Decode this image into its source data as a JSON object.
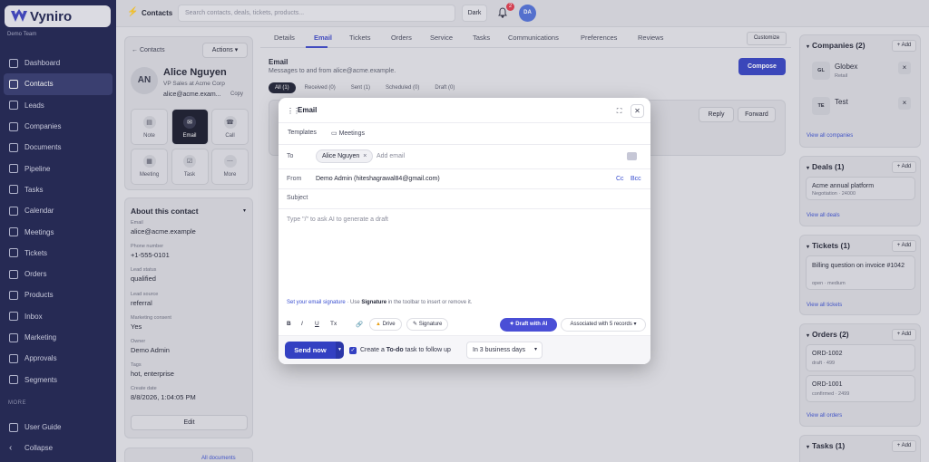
{
  "app": {
    "name": "Vyniro",
    "team": "Demo Team"
  },
  "sidebar": {
    "items": [
      {
        "label": "Dashboard",
        "icon": "home-icon"
      },
      {
        "label": "Contacts",
        "icon": "users-icon",
        "active": true
      },
      {
        "label": "Leads",
        "icon": "funnel-icon"
      },
      {
        "label": "Companies",
        "icon": "building-icon"
      },
      {
        "label": "Documents",
        "icon": "document-icon"
      },
      {
        "label": "Pipeline",
        "icon": "chart-icon"
      },
      {
        "label": "Tasks",
        "icon": "check-square-icon"
      },
      {
        "label": "Calendar",
        "icon": "calendar-icon"
      },
      {
        "label": "Meetings",
        "icon": "clock-icon"
      },
      {
        "label": "Tickets",
        "icon": "ticket-icon"
      },
      {
        "label": "Orders",
        "icon": "cart-icon"
      },
      {
        "label": "Products",
        "icon": "box-icon"
      },
      {
        "label": "Inbox",
        "icon": "inbox-icon"
      },
      {
        "label": "Marketing",
        "icon": "megaphone-icon"
      },
      {
        "label": "Approvals",
        "icon": "shield-check-icon"
      },
      {
        "label": "Segments",
        "icon": "segments-icon"
      }
    ],
    "more_label": "MORE",
    "bottom_items": [
      {
        "label": "User Guide",
        "icon": "book-icon"
      },
      {
        "label": "Collapse",
        "icon": "chevron-left-icon"
      }
    ]
  },
  "topbar": {
    "title": "Contacts",
    "search_placeholder": "Search contacts, deals, tickets, products...",
    "dark_label": "Dark",
    "notification_count": "2",
    "user_initials": "DA"
  },
  "contact": {
    "back_label": "Contacts",
    "actions_label": "Actions",
    "initials": "AN",
    "name": "Alice Nguyen",
    "role": "VP Sales at Acme Corp",
    "email_short": "alice@acme.exam...",
    "copy_label": "Copy",
    "quick_actions": [
      {
        "label": "Note",
        "icon": "note-icon"
      },
      {
        "label": "Email",
        "icon": "mail-icon",
        "active": true
      },
      {
        "label": "Call",
        "icon": "phone-icon"
      },
      {
        "label": "Meeting",
        "icon": "calendar-icon"
      },
      {
        "label": "Task",
        "icon": "check-square-icon"
      },
      {
        "label": "More",
        "icon": "more-icon"
      }
    ]
  },
  "about": {
    "title": "About this contact",
    "fields": [
      {
        "label": "Email",
        "value": "alice@acme.example"
      },
      {
        "label": "Phone number",
        "value": "+1-555-0101"
      },
      {
        "label": "Lead status",
        "value": "qualified"
      },
      {
        "label": "Lead source",
        "value": "referral"
      },
      {
        "label": "Marketing consent",
        "value": "Yes"
      },
      {
        "label": "Owner",
        "value": "Demo Admin"
      },
      {
        "label": "Tags",
        "value": "hot, enterprise"
      },
      {
        "label": "Create date",
        "value": "8/8/2026, 1:04:05 PM"
      }
    ],
    "edit_label": "Edit",
    "docs_link": "All documents"
  },
  "tabs": [
    "Details",
    "Email",
    "Tickets",
    "Orders",
    "Service",
    "Tasks",
    "Communications",
    "Preferences",
    "Reviews"
  ],
  "customize_label": "Customize",
  "email_panel": {
    "title": "Email",
    "subtitle": "Messages to and from alice@acme.example.",
    "compose_label": "Compose",
    "filters": [
      "All (1)",
      "Received (0)",
      "Sent (1)",
      "Scheduled (0)",
      "Draft (0)"
    ],
    "reply_label": "Reply",
    "forward_label": "Forward"
  },
  "right_panel": {
    "companies": {
      "title": "Companies (2)",
      "add_label": "+ Add",
      "items": [
        {
          "logo": "GL",
          "name": "Globex",
          "sub": "Retail"
        },
        {
          "logo": "TE",
          "name": "Test",
          "sub": ""
        }
      ],
      "link": "View all companies"
    },
    "deals": {
      "title": "Deals (1)",
      "add_label": "+ Add",
      "item": {
        "name": "Acme annual platform",
        "sub": "Negotiation · 24000"
      },
      "link": "View all deals"
    },
    "tickets": {
      "title": "Tickets (1)",
      "add_label": "+ Add",
      "item": {
        "name": "Billing question on invoice #1042",
        "sub": "open · medium"
      },
      "link": "View all tickets"
    },
    "orders": {
      "title": "Orders (2)",
      "add_label": "+ Add",
      "items": [
        {
          "name": "ORD-1002",
          "sub": "draft · 499"
        },
        {
          "name": "ORD-1001",
          "sub": "confirmed · 2499"
        }
      ],
      "link": "View all orders"
    },
    "tasks": {
      "title": "Tasks (1)",
      "add_label": "+ Add"
    }
  },
  "modal": {
    "title": "Email",
    "templates_label": "Templates",
    "meetings_label": "Meetings",
    "to_label": "To",
    "to_chip": "Alice Nguyen",
    "add_email_placeholder": "Add email",
    "from_label": "From",
    "from_value": "Demo Admin (hiteshagrawal84@gmail.com)",
    "cc_label": "Cc",
    "bcc_label": "Bcc",
    "subject_placeholder": "Subject",
    "body_placeholder": "Type \"/\" to ask AI to generate a draft",
    "signature_link": "Set your email signature",
    "signature_mid": " · Use ",
    "signature_bold": "Signature",
    "signature_tail": " in the toolbar to insert or remove it.",
    "format": [
      "B",
      "I",
      "U",
      "Tx"
    ],
    "drive_label": "Drive",
    "signature_btn": "Signature",
    "ai_label": "Draft with AI",
    "associated_label": "Associated with 5 records",
    "send_label": "Send now",
    "todo_pre": "Create a ",
    "todo_bold": "To-do",
    "todo_post": " task to follow up",
    "days_value": "In 3 business days"
  },
  "colors": {
    "sidebar_bg": "#1b1f4e",
    "primary": "#3340c2",
    "ai_button": "#4a4fd6",
    "badge": "#e0394c"
  }
}
